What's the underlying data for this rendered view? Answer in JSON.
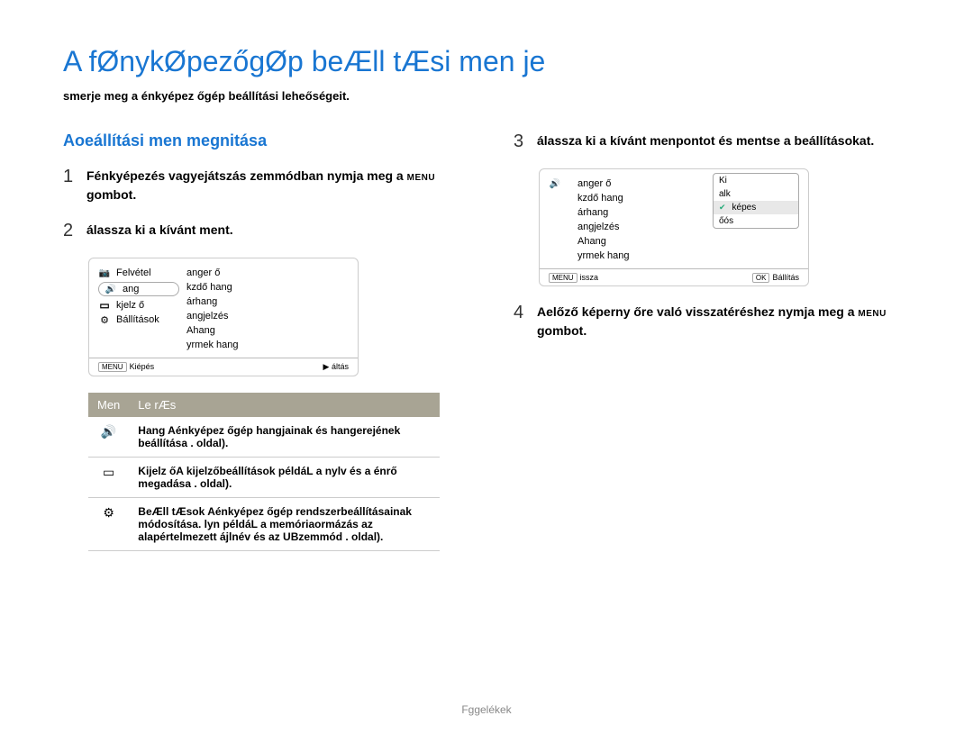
{
  "title": "A fØnykØpezőgØp beÆll tÆsi men je",
  "subtitle": "smerje meg a énkyépez őgép beállítási leheőségeit.",
  "section_heading": "Aoeállítási men megnitása",
  "steps": {
    "s1": {
      "num": "1",
      "text_a": "Fénkyépezés vagyejátszás zemmódban nymja meg a ",
      "menu": "MENU",
      "text_b": " gombot."
    },
    "s2": {
      "num": "2",
      "text": "álassza ki a kívánt ment."
    },
    "s3": {
      "num": "3",
      "text": "álassza ki a kívánt menpontot és mentse a beállításokat."
    },
    "s4": {
      "num": "4",
      "text_a": "Aelőző képerny őre való visszatéréshez nymja meg a ",
      "menu": "MENU",
      "text_b": " gombot."
    }
  },
  "screen1": {
    "left_items": [
      {
        "icon": "camera",
        "label": "Felvétel"
      },
      {
        "icon": "sound",
        "label": "ang",
        "hl": true
      },
      {
        "icon": "display",
        "label": "kjelz ő"
      },
      {
        "icon": "gear",
        "label": "Bállítások"
      }
    ],
    "right_items": [
      "anger ő",
      "kzdő hang",
      "árhang",
      "angjelzés",
      "Ahang",
      "yrmek hang"
    ],
    "footer_left_btn": "MENU",
    "footer_left": "Kiépés",
    "footer_right_btn": "▶",
    "footer_right": "áltás"
  },
  "screen2": {
    "left_icon": "sound",
    "right_items": [
      "anger ő",
      "kzdő hang",
      "árhang",
      "angjelzés",
      "Ahang",
      "yrmek hang"
    ],
    "popup": [
      "Ki",
      "alk",
      "képes",
      "őós"
    ],
    "popup_sel_index": 2,
    "footer_left_btn": "MENU",
    "footer_left": "issza",
    "footer_right_btn": "OK",
    "footer_right": "Bállítás"
  },
  "menu_table": {
    "header_menu": "Men",
    "header_desc": "Le rÆs",
    "rows": [
      {
        "icon": "🔊",
        "desc": "Hang Aénkyépez     őgép hangjainak és hangerejének beállítása . oldal)."
      },
      {
        "icon": "▭",
        "desc": "Kijelz őA kijelzőbeállítások példáL a nylv és a énrő megadása . oldal)."
      },
      {
        "icon": "⚙",
        "desc": "BeÆll tÆsok Aénkyépez    őgép rendszerbeállításainak módosítása. lyn példáL a memóriaormázás az alapértelmezett ájlnév és az UBzemmód . oldal)."
      }
    ]
  },
  "footer": "Fggelékek"
}
